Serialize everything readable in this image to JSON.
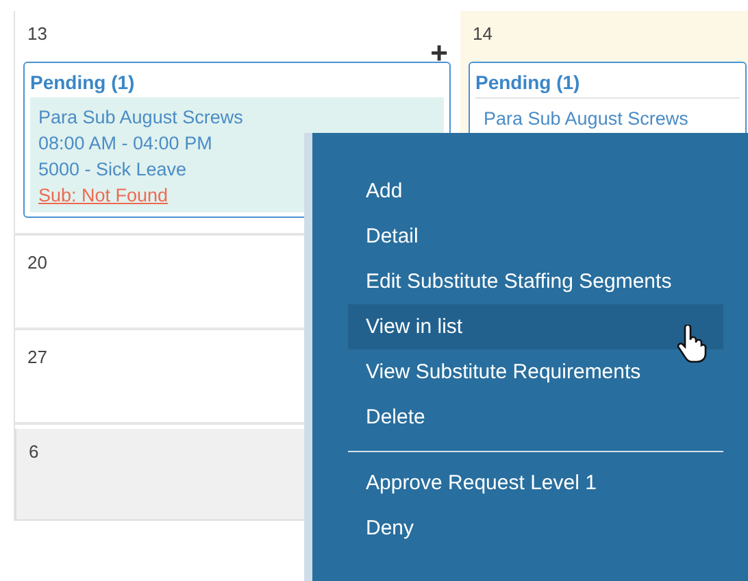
{
  "calendar": {
    "days": [
      {
        "date": "13",
        "today": false,
        "outside_month": false,
        "add_button": "+",
        "requests": {
          "title": "Pending (1)",
          "items": [
            {
              "lines": [
                "Para Sub August Screws",
                "08:00 AM - 04:00 PM",
                "5000 - Sick Leave"
              ],
              "sub_link": "Sub: Not Found"
            }
          ]
        }
      },
      {
        "date": "14",
        "today": true,
        "outside_month": false,
        "requests": {
          "title": "Pending (1)",
          "items": [
            {
              "lines": [
                "Para Sub August Screws"
              ]
            }
          ]
        }
      },
      {
        "date": "20",
        "today": false,
        "outside_month": false
      },
      {
        "date": "27",
        "today": false,
        "outside_month": false
      },
      {
        "date": "6",
        "today": false,
        "outside_month": true
      }
    ]
  },
  "context_menu": {
    "items": [
      {
        "kind": "item",
        "label": "Add",
        "selected": false
      },
      {
        "kind": "item",
        "label": "Detail",
        "selected": false
      },
      {
        "kind": "item",
        "label": "Edit Substitute Staffing Segments",
        "selected": false
      },
      {
        "kind": "item",
        "label": "View in list",
        "selected": true
      },
      {
        "kind": "item",
        "label": "View Substitute Requirements",
        "selected": false
      },
      {
        "kind": "item",
        "label": "Delete",
        "selected": false
      },
      {
        "kind": "divider"
      },
      {
        "kind": "item",
        "label": "Approve Request Level 1",
        "selected": false
      },
      {
        "kind": "item",
        "label": "Deny",
        "selected": false
      }
    ]
  }
}
